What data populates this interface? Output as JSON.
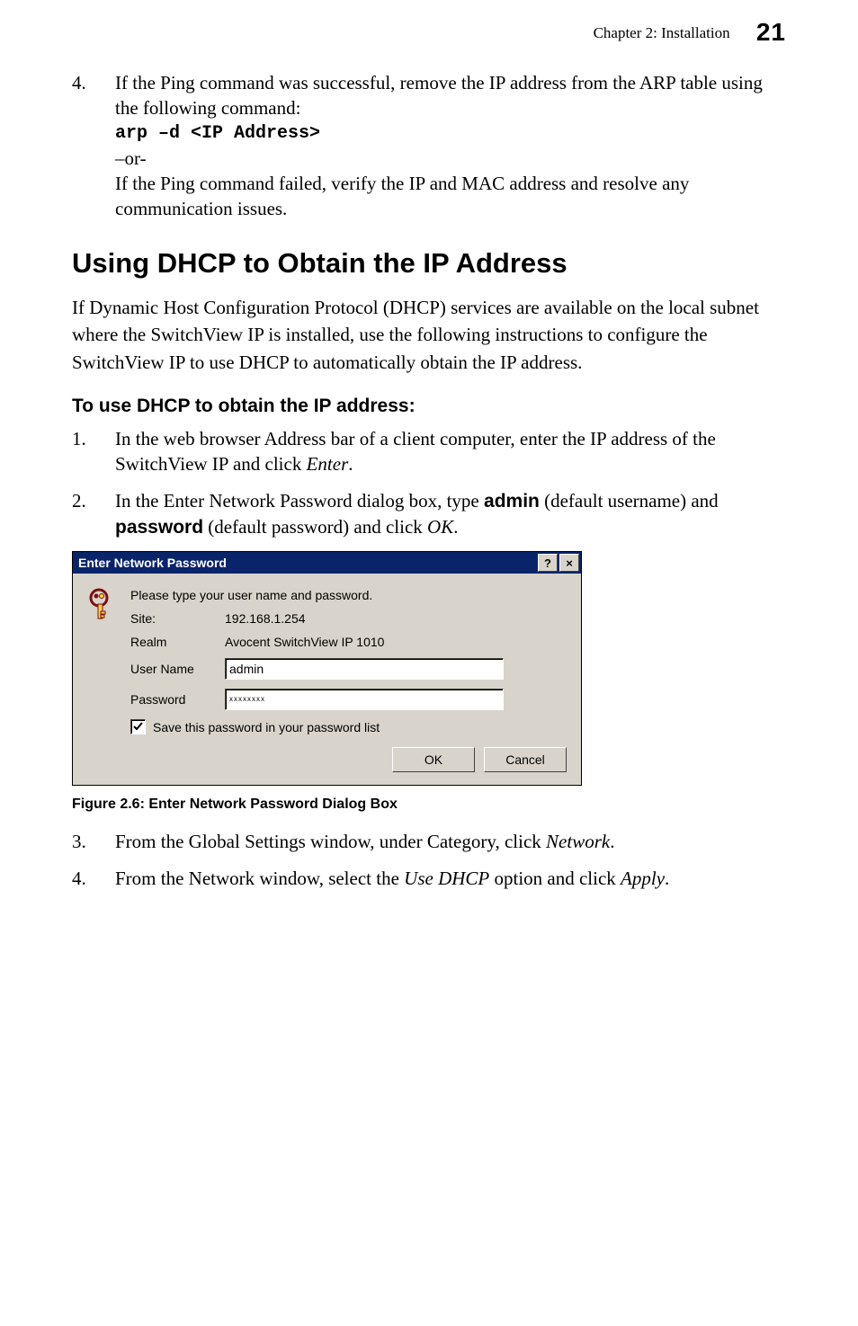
{
  "header": {
    "chapter": "Chapter 2: Installation",
    "page_number": "21"
  },
  "step4a": {
    "num": "4.",
    "line1": "If the Ping command was successful, remove the IP address from the ARP table using the following command:",
    "code": "arp –d <IP Address>",
    "or": "–or-",
    "line2": "If the Ping command failed, verify the IP and MAC address and resolve any communication issues."
  },
  "h2": "Using DHCP to Obtain the IP Address",
  "intro": "If Dynamic Host Configuration Protocol (DHCP) services are available on the local subnet where the SwitchView IP is installed, use the following instructions to configure the SwitchView IP to use DHCP to automatically obtain the IP address.",
  "h3": "To use DHCP to obtain the IP address:",
  "step1": {
    "num": "1.",
    "text_a": "In the web browser Address bar of a client computer, enter the IP address of the SwitchView IP and click ",
    "enter": "Enter",
    "text_b": "."
  },
  "step2": {
    "num": "2.",
    "text_a": "In the Enter Network Password dialog box, type ",
    "admin": "admin",
    "text_b": " (default username) and ",
    "password": "password",
    "text_c": " (default password) and click ",
    "ok": "OK",
    "text_d": "."
  },
  "dialog": {
    "title": "Enter Network Password",
    "help": "?",
    "close": "×",
    "instruction": "Please type your user name and password.",
    "site_label": "Site:",
    "site_value": "192.168.1.254",
    "realm_label": "Realm",
    "realm_value": "Avocent SwitchView IP 1010",
    "user_label": "User Name",
    "user_value": "admin",
    "pass_label": "Password",
    "pass_value": "xxxxxxxx",
    "save_label": "Save this password in your password list",
    "ok_btn": "OK",
    "cancel_btn": "Cancel"
  },
  "figure_caption": "Figure 2.6: Enter Network Password Dialog Box",
  "step3": {
    "num": "3.",
    "text_a": "From the Global Settings window, under Category, click ",
    "network": "Network",
    "text_b": "."
  },
  "step4b": {
    "num": "4.",
    "text_a": "From the Network window, select the ",
    "usedhcp": "Use DHCP",
    "text_b": " option and click ",
    "apply": "Apply",
    "text_c": "."
  }
}
